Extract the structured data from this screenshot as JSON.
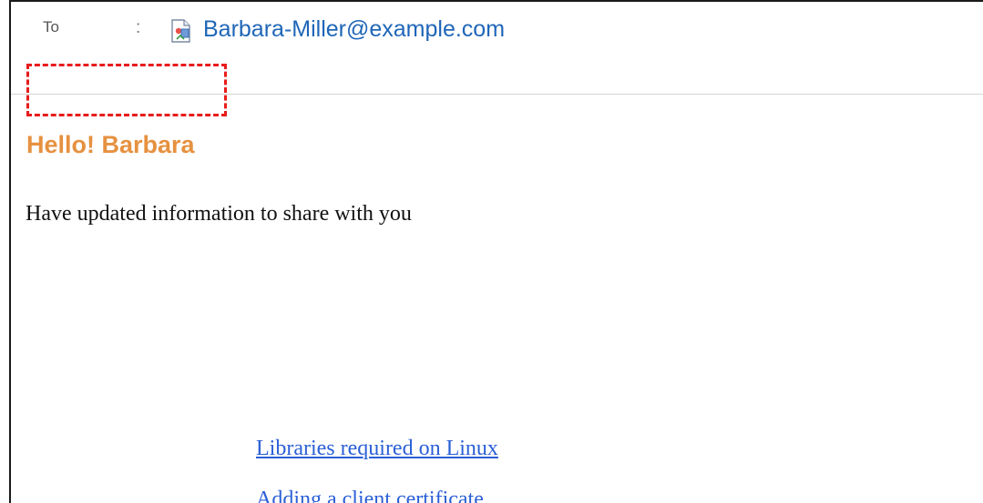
{
  "email": {
    "to_label": "To",
    "to_separator": ":",
    "recipient": "Barbara-Miller@example.com",
    "recipient_icon": "address-card-icon"
  },
  "message": {
    "greeting": "Hello! Barbara",
    "body": "Have updated information to share with you",
    "links": [
      {
        "label": "Libraries required on Linux"
      },
      {
        "label": "Adding a client certificate"
      }
    ]
  },
  "colors": {
    "greeting": "#e69140",
    "link": "#2a5fd6",
    "recipient": "#1f66b8",
    "highlight": "#e81c1c"
  }
}
